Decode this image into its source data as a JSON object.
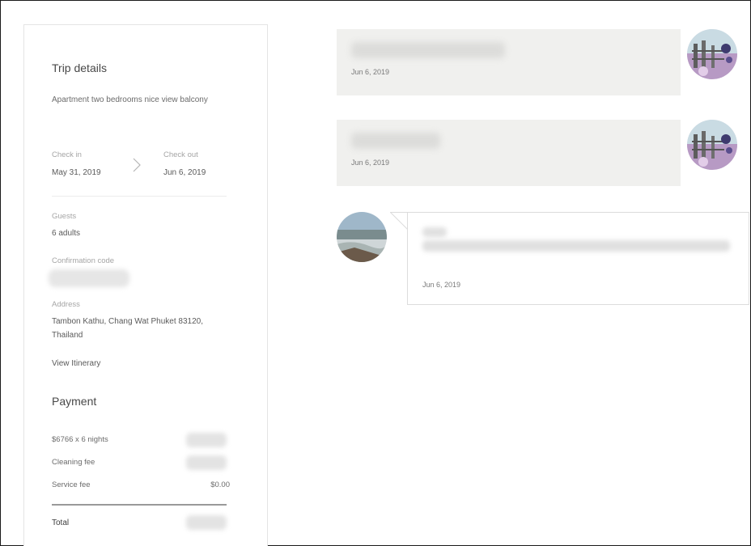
{
  "trip": {
    "title": "Trip details",
    "listing": "Apartment two bedrooms nice view balcony",
    "check_in_label": "Check in",
    "check_in_date": "May 31, 2019",
    "check_out_label": "Check out",
    "check_out_date": "Jun 6, 2019",
    "guests_label": "Guests",
    "guests_value": "6 adults",
    "confirmation_label": "Confirmation code",
    "address_label": "Address",
    "address_value": "Tambon Kathu, Chang Wat Phuket 83120, Thailand",
    "itinerary_link": "View Itinerary"
  },
  "payment": {
    "title": "Payment",
    "rows": [
      {
        "label": "$6766 x 6 nights"
      },
      {
        "label": "Cleaning fee"
      },
      {
        "label": "Service fee",
        "amount": "$0.00"
      }
    ],
    "total_label": "Total"
  },
  "messages": [
    {
      "from": "host",
      "date": "Jun 6, 2019"
    },
    {
      "from": "host",
      "date": "Jun 6, 2019"
    },
    {
      "from": "guest",
      "date": "Jun 6, 2019"
    }
  ],
  "colors": {
    "host_bubble": "#f0f0ee",
    "guest_bubble_border": "#dcdcdc",
    "panel_border": "#e4e4e4",
    "text_primary": "#484848",
    "text_muted": "#a5a5a5"
  },
  "icons": {
    "chevron": "chevron-right-icon"
  }
}
